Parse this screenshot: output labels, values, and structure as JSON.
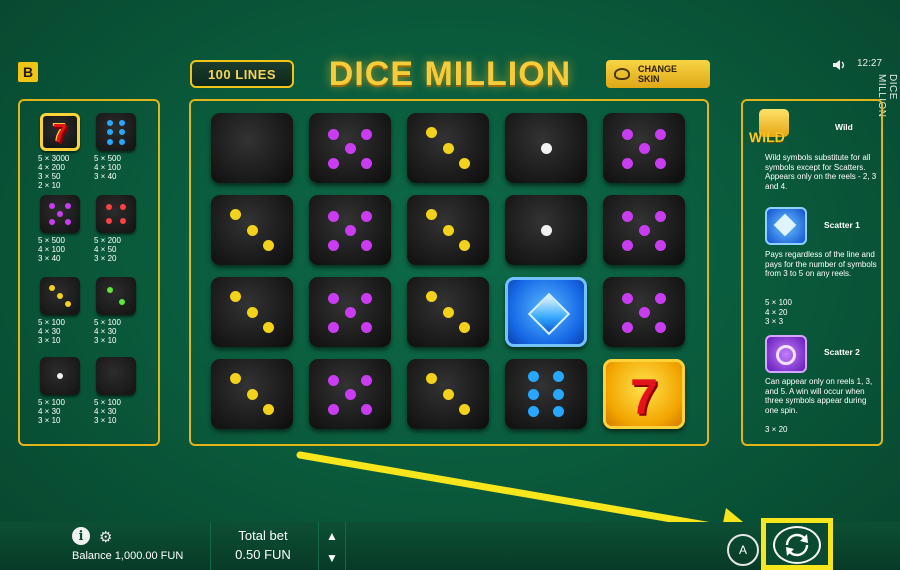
{
  "header": {
    "logo_letter": "B",
    "lines_button": "100 LINES",
    "title": "DICE MILLION",
    "change_skin": "CHANGE SKIN",
    "time": "12:27",
    "vertical_title": "DICE MILLION"
  },
  "paytable_left": [
    {
      "symbol": "seven",
      "lines": [
        "5 × 3000",
        "4 × 200",
        "3 × 50",
        "2 × 10"
      ]
    },
    {
      "symbol": "blue-six",
      "lines": [
        "5 × 500",
        "4 × 100",
        "3 × 40"
      ]
    },
    {
      "symbol": "purple-five",
      "lines": [
        "5 × 500",
        "4 × 100",
        "3 × 40"
      ]
    },
    {
      "symbol": "red-four",
      "lines": [
        "5 × 200",
        "4 × 50",
        "3 × 20"
      ]
    },
    {
      "symbol": "yellow-three",
      "lines": [
        "5 × 100",
        "4 × 30",
        "3 × 10"
      ]
    },
    {
      "symbol": "green-two",
      "lines": [
        "5 × 100",
        "4 × 30",
        "3 × 10"
      ]
    },
    {
      "symbol": "white-one",
      "lines": [
        "5 × 100",
        "4 × 30",
        "3 × 10"
      ]
    },
    {
      "symbol": "blank",
      "lines": [
        "5 × 100",
        "4 × 30",
        "3 × 10"
      ]
    }
  ],
  "reels": [
    [
      "blank",
      "purple-five",
      "yellow-three",
      "white-one",
      "purple-five"
    ],
    [
      "yellow-three",
      "purple-five",
      "yellow-three",
      "white-one",
      "purple-five"
    ],
    [
      "yellow-three",
      "purple-five",
      "yellow-three",
      "scatter-blue",
      "purple-five"
    ],
    [
      "yellow-three",
      "purple-five",
      "yellow-three",
      "blue-six",
      "seven"
    ]
  ],
  "paytable_right": {
    "wild_label": "Wild",
    "wild_icon_text": "WILD",
    "wild_desc": "Wild symbols substitute for all symbols except for Scatters. Appears only on the reels - 2, 3 and 4.",
    "scatter1_label": "Scatter 1",
    "scatter1_desc": "Pays regardless of the line and pays for the number of symbols from 3 to 5 on any reels.",
    "scatter1_pays": [
      "5 × 100",
      "4 × 20",
      "3 × 3"
    ],
    "scatter2_label": "Scatter 2",
    "scatter2_desc": "Can appear only on reels 1, 3, and 5. A win will occur when three symbols appear during one spin.",
    "scatter2_pays": [
      "3 × 20"
    ]
  },
  "bottom_bar": {
    "balance": "Balance 1,000.00 FUN",
    "total_bet_label": "Total bet",
    "total_bet_value": "0.50 FUN",
    "auto_label": "A"
  },
  "colors": {
    "background": "#0a5a3c",
    "gold": "#e1b41c",
    "highlight": "#f7e61b",
    "purple_pip": "#c93df0",
    "yellow_pip": "#f3d21c",
    "blue_pip": "#27a7ff",
    "red_pip": "#ff4040",
    "green_pip": "#5ee83a"
  }
}
